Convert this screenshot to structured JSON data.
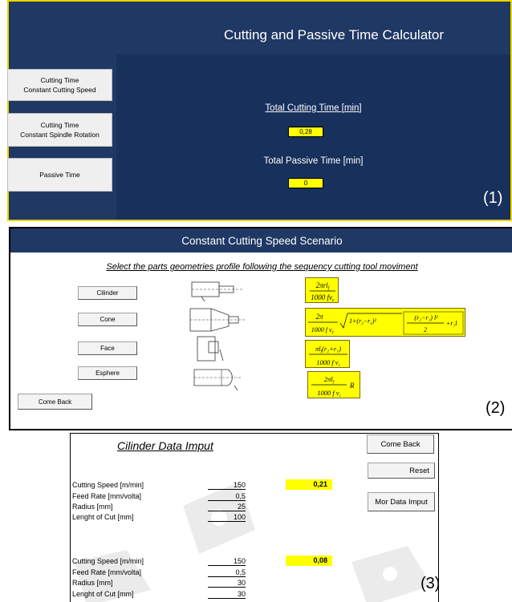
{
  "panel1": {
    "title": "Cutting and Passive Time Calculator",
    "buttons": [
      {
        "label": "Cutting Time\nConstant Cutting Speed"
      },
      {
        "label": "Cutting Time\nConstant Spindle Rotation"
      },
      {
        "label": "Passive Time"
      }
    ],
    "total_cutting_label": "Total Cutting Time [min]",
    "total_cutting_value": "0,28",
    "total_passive_label": "Total Passive Time [min]",
    "total_passive_value": "0",
    "tag": "(1)"
  },
  "panel2": {
    "title": "Constant Cutting Speed Scenario",
    "instruction": "Select the parts geometries profile following the sequency cutting tool moviment",
    "buttons": [
      "Cilinder",
      "Cone",
      "Face",
      "Esphere"
    ],
    "come_back": "Come Back",
    "tag": "(2)"
  },
  "panel3": {
    "title": "Cilinder Data Imput",
    "come_back": "Come Back",
    "reset": "Reset",
    "more_data": "Mor Data Imput",
    "groups": [
      {
        "rows": [
          {
            "label": "Cutting Speed [m/min]",
            "value": "150"
          },
          {
            "label": "Feed Rate [mm/volta]",
            "value": "0,5"
          },
          {
            "label": "Radius [mm]",
            "value": "25"
          },
          {
            "label": "Lenght of Cut [mm]",
            "value": "100"
          }
        ],
        "result": "0,21"
      },
      {
        "rows": [
          {
            "label": "Cutting Speed [m/min]",
            "value": "150"
          },
          {
            "label": "Feed Rate [mm/volta]",
            "value": "0,5"
          },
          {
            "label": "Radius [mm]",
            "value": "30"
          },
          {
            "label": "Lenght of Cut [mm]",
            "value": "30"
          }
        ],
        "result": "0,08"
      }
    ],
    "tag": "(3)"
  },
  "colors": {
    "navy": "#1f3864",
    "highlight": "#ffff00",
    "border_gold": "#e8d400"
  }
}
